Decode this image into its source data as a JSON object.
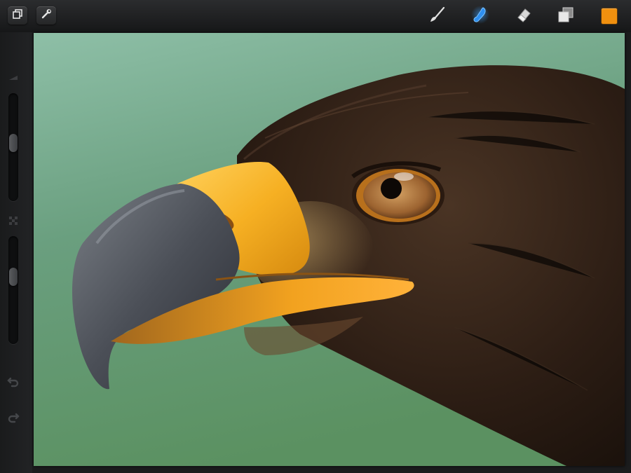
{
  "app": {
    "accent_color": "#3aa0ff",
    "swatch_color": "#f0900f"
  },
  "toolbar": {
    "left_buttons": [
      {
        "icon": "gallery-icon"
      },
      {
        "icon": "wrench-icon"
      }
    ],
    "tools": [
      {
        "icon": "brush-icon",
        "active": false
      },
      {
        "icon": "smudge-icon",
        "active": true
      },
      {
        "icon": "eraser-icon",
        "active": false
      },
      {
        "icon": "layers-icon",
        "active": false
      },
      {
        "icon": "color-swatch",
        "active": false
      }
    ]
  },
  "sidebar": {
    "brush_size_level": 0.45,
    "opacity_level": 0.35,
    "icons": [
      "size-icon",
      "opacity-icon",
      "undo-icon",
      "redo-icon"
    ]
  },
  "canvas": {
    "subject": "eagle-painting"
  }
}
